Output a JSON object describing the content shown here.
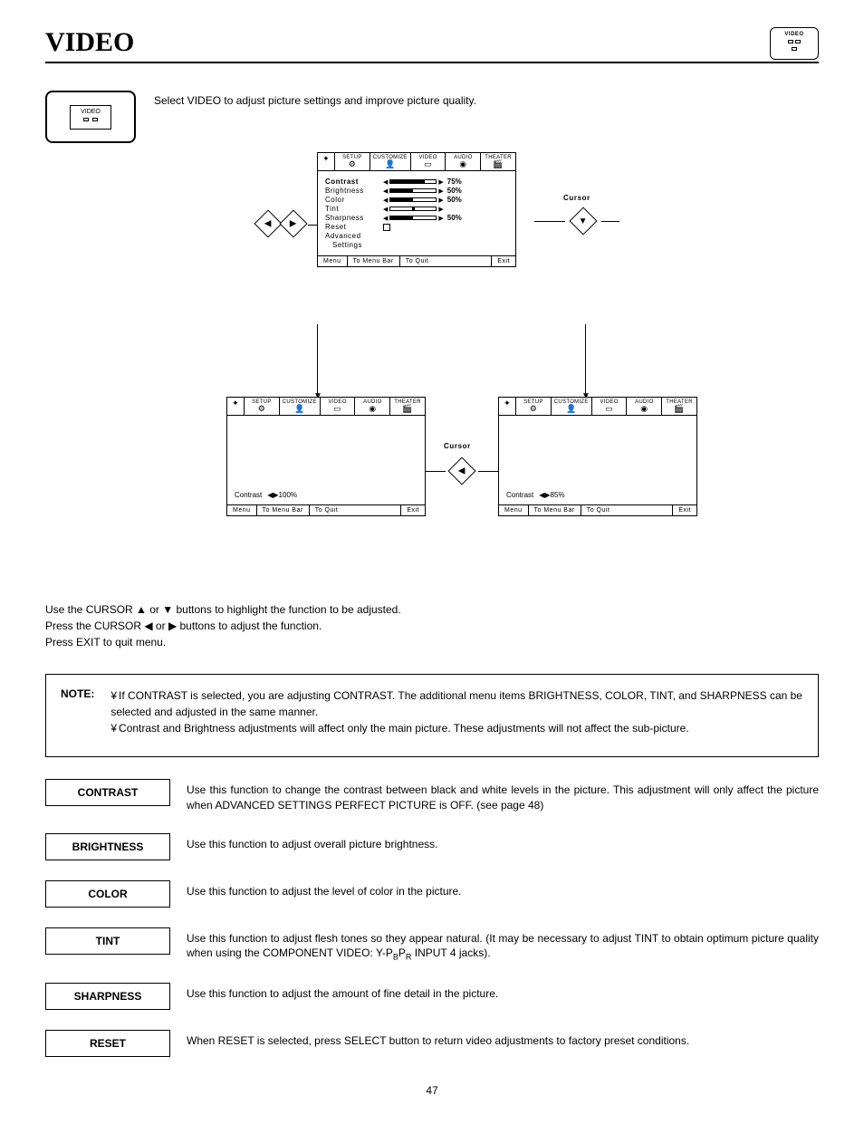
{
  "page": {
    "title": "VIDEO",
    "number": "47"
  },
  "corner_badge": "VIDEO",
  "intro": "Select VIDEO to adjust picture settings and improve picture quality.",
  "osd": {
    "tabs": [
      "SETUP",
      "CUSTOMIZE",
      "VIDEO",
      "AUDIO",
      "THEATER"
    ],
    "items": {
      "contrast": "Contrast",
      "brightness": "Brightness",
      "color": "Color",
      "tint": "Tint",
      "sharpness": "Sharpness",
      "reset": "Reset",
      "advanced": "Advanced",
      "settings": "Settings"
    },
    "values": {
      "contrast": "75%",
      "brightness": "50%",
      "color": "50%",
      "tint": "",
      "sharpness": "50%",
      "contrast_b": "100%",
      "contrast_c": "85%"
    },
    "footer": {
      "menu": "Menu",
      "menubar": "To Menu Bar",
      "quit": "To Quit",
      "exit": "Exit"
    }
  },
  "labels": {
    "cursor": "Cursor"
  },
  "instructions": {
    "l1a": "Use the CURSOR ",
    "l1b": " or ",
    "l1c": " buttons to highlight the function to be adjusted.",
    "l2a": "Press the CURSOR ",
    "l2b": " or ",
    "l2c": " buttons to adjust the function.",
    "l3": "Press EXIT to quit menu."
  },
  "arrows": {
    "up": "▲",
    "down": "▼",
    "left": "◀",
    "right": "▶"
  },
  "note": {
    "label": "NOTE:",
    "b1": "If CONTRAST is selected, you are adjusting CONTRAST.  The additional menu items BRIGHTNESS, COLOR, TINT, and SHARPNESS can be selected and adjusted in the same manner.",
    "b2": "Contrast and Brightness adjustments will affect only the main picture. These adjustments will not affect the sub-picture."
  },
  "defs": {
    "contrast": {
      "term": "CONTRAST",
      "desc": "Use this function to change the contrast between black and white levels in the picture.  This adjustment will only affect the picture when ADVANCED SETTINGS PERFECT PICTURE is OFF. (see page 48)"
    },
    "brightness": {
      "term": "BRIGHTNESS",
      "desc": "Use this function to adjust overall picture brightness."
    },
    "color": {
      "term": "COLOR",
      "desc": "Use this function to adjust the level of color in the picture."
    },
    "tint": {
      "term": "TINT",
      "desc_a": "Use this function to adjust flesh tones so they appear natural. (It may be necessary to adjust TINT to obtain optimum picture quality when using the COMPONENT VIDEO: Y-P",
      "desc_b": "B",
      "desc_c": "P",
      "desc_d": "R",
      "desc_e": " INPUT 4 jacks)."
    },
    "sharpness": {
      "term": "SHARPNESS",
      "desc": "Use this function to adjust the amount of fine detail in the picture."
    },
    "reset": {
      "term": "RESET",
      "desc": "When RESET is selected, press SELECT button to return video adjustments to factory preset conditions."
    }
  }
}
